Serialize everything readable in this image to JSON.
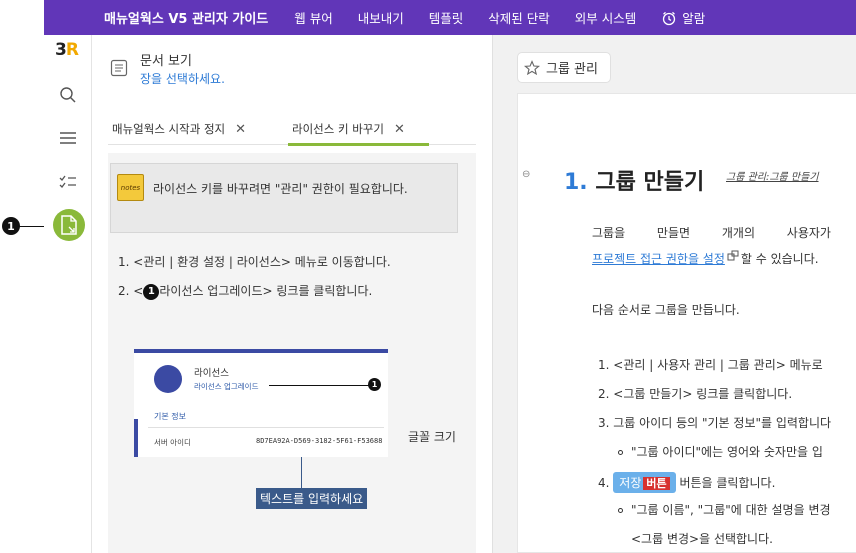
{
  "topbar": {
    "title": "매뉴얼웍스 V5 관리자 가이드",
    "nav": [
      "웹 뷰어",
      "내보내기",
      "템플릿",
      "삭제된 단락",
      "외부 시스템"
    ],
    "alarm": "알람"
  },
  "rail": {
    "logo_text": "3",
    "logo_accent": "R",
    "icons": [
      "search-icon",
      "menu-icon",
      "checklist-icon",
      "document-view-icon"
    ],
    "accent_color": "#8ab93a"
  },
  "callout": {
    "rail_marker": "1"
  },
  "middle": {
    "title": "문서 보기",
    "subtitle": "장을 선택하세요.",
    "tabs": [
      {
        "label": "매뉴얼웍스 시작과 정지",
        "active": false
      },
      {
        "label": "라이선스 키 바꾸기",
        "active": true
      }
    ],
    "note_icon_text": "notes",
    "note_text": "라이선스 키를 바꾸려면 \"관리\" 권한이 필요합니다.",
    "steps": [
      "1. <관리 | 환경 설정 | 라이선스> 메뉴로 이동합니다.",
      "2. <",
      "라이선스 업그레이드> 링크를 클릭합니다."
    ],
    "step_marker": "1",
    "thumb": {
      "license_label": "라이선스",
      "upgrade_link": "라이선스 업그레이드",
      "marker": "1",
      "info_title": "기본 정보",
      "server_key": "서버 아이디",
      "server_value": "8D7EA92A-D569-3182-5F61-F53688"
    },
    "font_size_label": "글꼴 크기",
    "input_placeholder_box": "텍스트를 입력하세요"
  },
  "right": {
    "fav_label": "그룹 관리",
    "collapse_symbol": "⊖",
    "heading_num": "1.",
    "heading_text": "그룹 만들기",
    "heading_link": "그룹 관리:그룹 만들기",
    "p1": "그룹을 만들면 개개의 사용자가",
    "p1_link": "프로젝트 접근 권한을 설정",
    "p1_tail": "할 수 있습니다.",
    "p2": "다음 순서로 그룹을 만듭니다.",
    "list": [
      "1. <관리 | 사용자 관리 | 그룹 관리> 메뉴로",
      "2. <그룹 만들기> 링크를 클릭합니다.",
      "3. 그룹 아이디 등의 \"기본 정보\"를 입력합니다",
      "\"그룹 아이디\"에는 영어와 숫자만을 입",
      "4.",
      "버튼을 클릭합니다.",
      "\"그룹 이름\", \"그룹\"에 대한 설명을 변경",
      "<그룹 변경>을 선택합니다."
    ],
    "save_chip": "저장",
    "save_chip_tag": "버튼"
  }
}
